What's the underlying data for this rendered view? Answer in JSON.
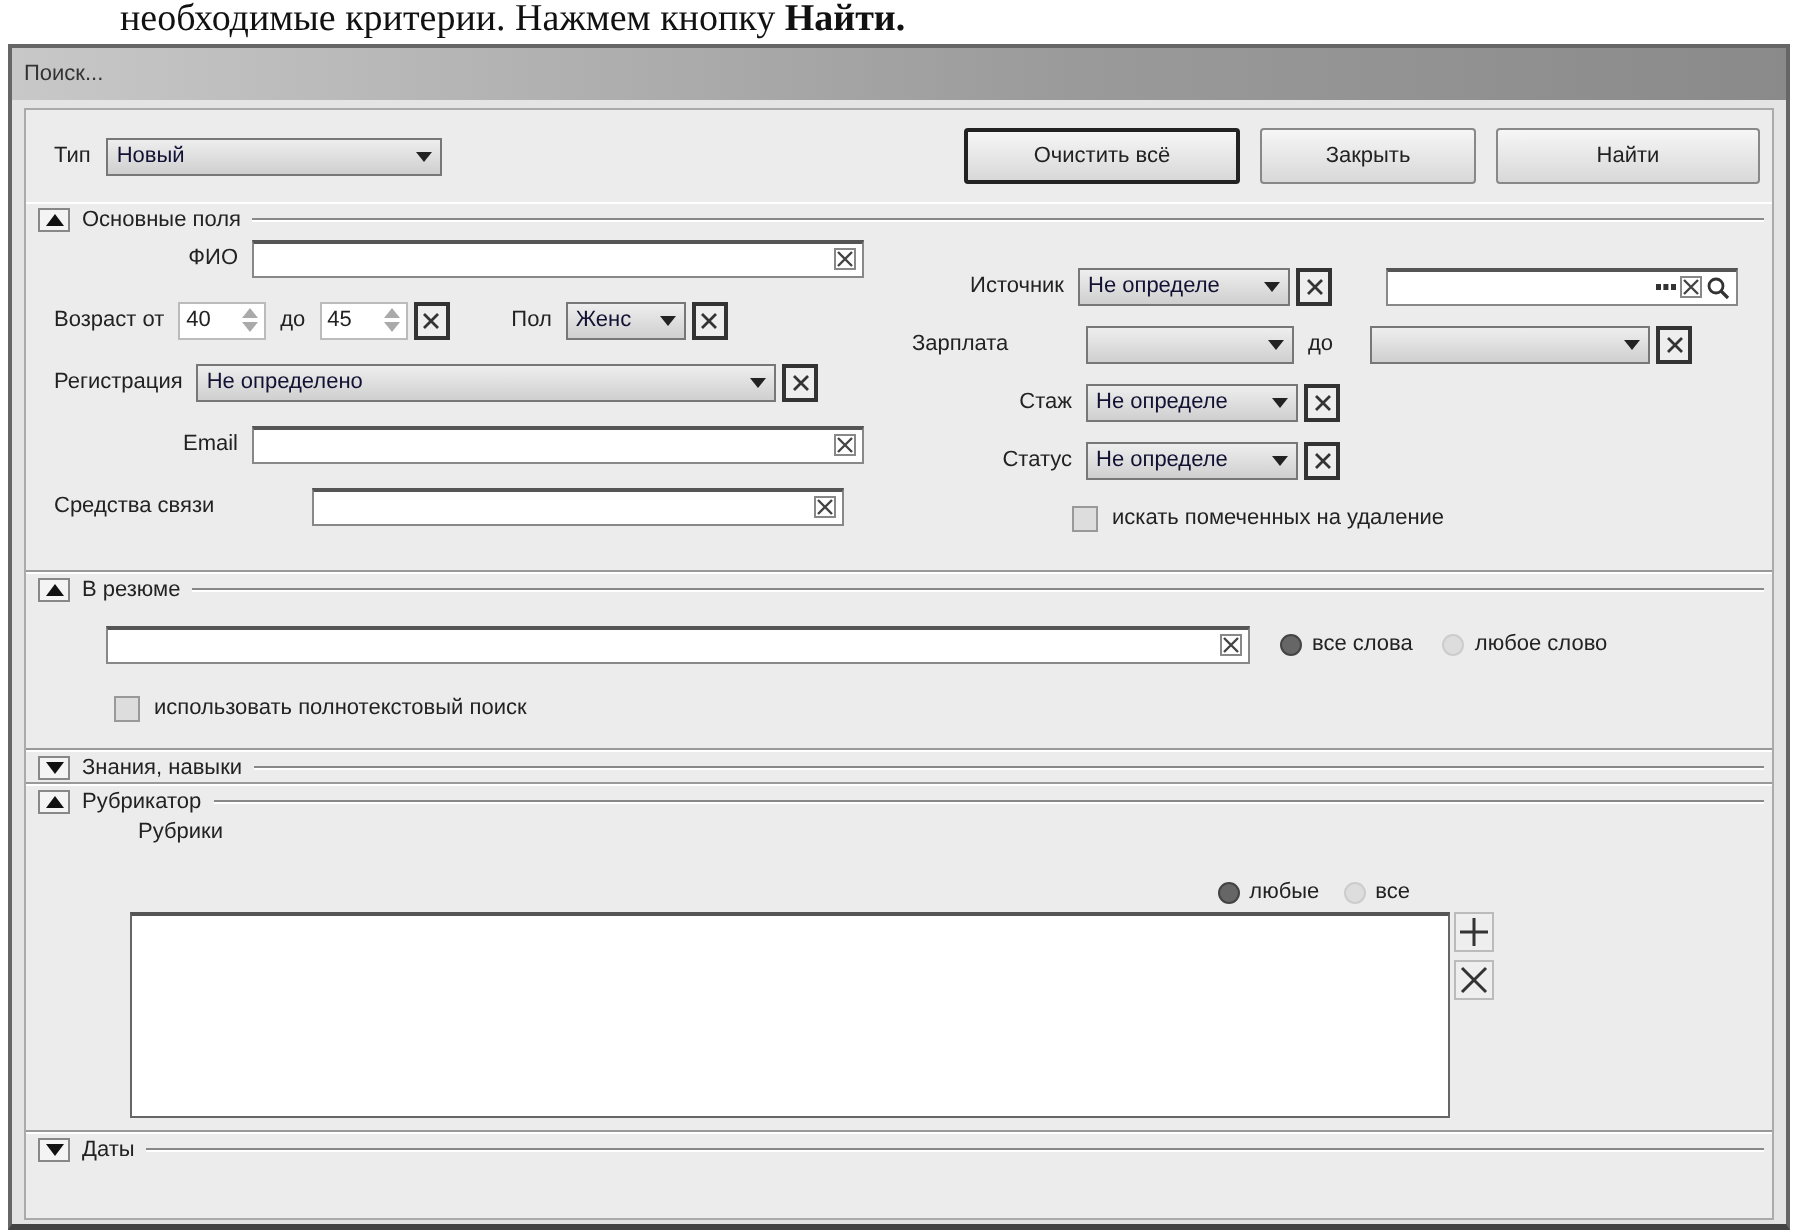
{
  "caption": "необходимые критерии. Нажмем кнопку **Найти.**",
  "window": {
    "title": "Поиск..."
  },
  "toolbar": {
    "type_label": "Тип",
    "type_value": "Новый",
    "buttons": [
      {
        "label": "Очистить всё",
        "default": true
      },
      {
        "label": "Закрыть",
        "default": false
      },
      {
        "label": "Найти",
        "default": false
      }
    ]
  },
  "main_fields": {
    "title": "Основные поля",
    "expanded": true,
    "fio": {
      "label": "ФИО"
    },
    "age": {
      "label": "Возраст от",
      "from": "40",
      "to_label": "до",
      "to": "45"
    },
    "gender": {
      "label": "Пол",
      "value": "Женс"
    },
    "registration": {
      "label": "Регистрация",
      "value": "Не определено"
    },
    "email": {
      "label": "Email"
    },
    "contacts": {
      "label": "Средства связи"
    },
    "source": {
      "label": "Источник",
      "value": "Не определе"
    },
    "salary": {
      "label": "Зарплата",
      "to_label": "до"
    },
    "experience": {
      "label": "Стаж",
      "value": "Не определе"
    },
    "status": {
      "label": "Статус",
      "value": "Не определе"
    },
    "deleted": {
      "label": "искать помеченных на удаление",
      "checked": false
    }
  },
  "resume": {
    "title": "В резюме",
    "expanded": true,
    "match": [
      {
        "label": "все слова",
        "selected": true
      },
      {
        "label": "любое слово",
        "selected": false
      }
    ],
    "fulltext": {
      "label": "использовать полнотекстовый поиск",
      "checked": false
    }
  },
  "skills": {
    "title": "Знания, навыки",
    "expanded": false
  },
  "rubricator": {
    "title": "Рубрикатор",
    "expanded": true,
    "list_label": "Рубрики",
    "match": [
      {
        "label": "любые",
        "selected": true
      },
      {
        "label": "все",
        "selected": false
      }
    ]
  },
  "dates": {
    "title": "Даты",
    "expanded": false
  }
}
